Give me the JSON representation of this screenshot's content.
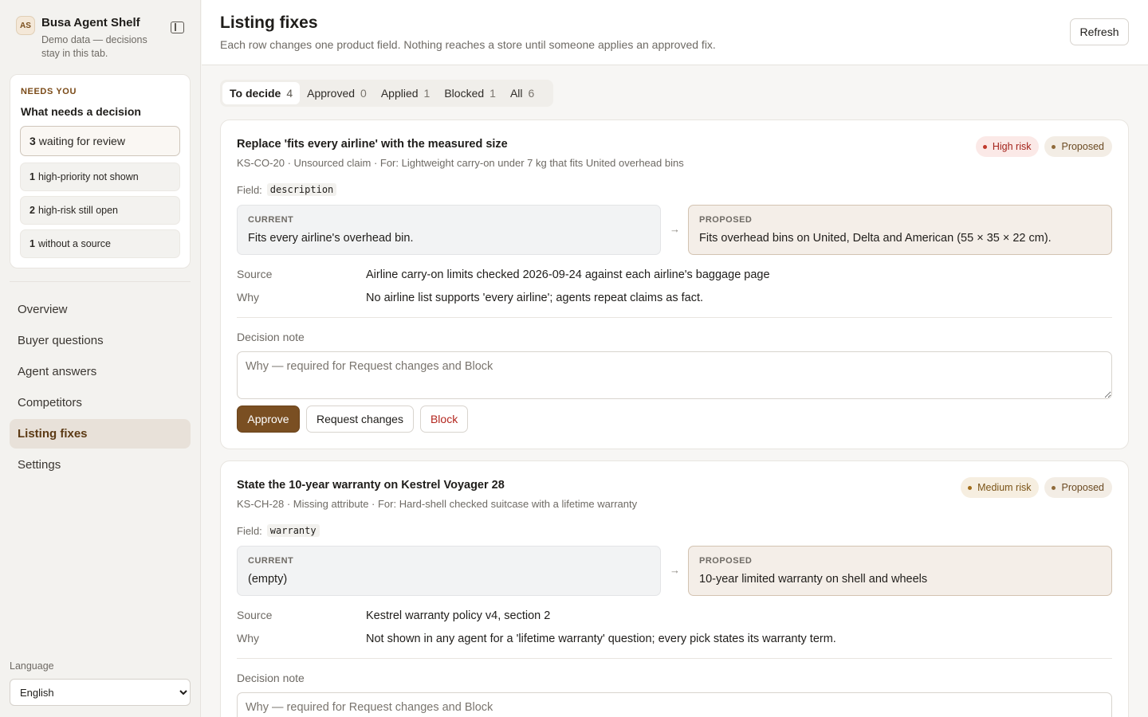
{
  "sidebar": {
    "avatar_initials": "AS",
    "brand_name": "Busa Agent Shelf",
    "brand_sub": "Demo data — decisions stay in this tab.",
    "needs": {
      "eyebrow": "NEEDS YOU",
      "title": "What needs a decision",
      "items": [
        {
          "count": "3",
          "label": "waiting for review"
        },
        {
          "count": "1",
          "label": "high-priority not shown"
        },
        {
          "count": "2",
          "label": "high-risk still open"
        },
        {
          "count": "1",
          "label": "without a source"
        }
      ]
    },
    "nav": [
      {
        "label": "Overview"
      },
      {
        "label": "Buyer questions"
      },
      {
        "label": "Agent answers"
      },
      {
        "label": "Competitors"
      },
      {
        "label": "Listing fixes"
      },
      {
        "label": "Settings"
      }
    ],
    "language_label": "Language",
    "language_value": "English"
  },
  "header": {
    "title": "Listing fixes",
    "subtitle": "Each row changes one product field. Nothing reaches a store until someone applies an approved fix.",
    "refresh_label": "Refresh"
  },
  "tabs": [
    {
      "label": "To decide",
      "count": "4"
    },
    {
      "label": "Approved",
      "count": "0"
    },
    {
      "label": "Applied",
      "count": "1"
    },
    {
      "label": "Blocked",
      "count": "1"
    },
    {
      "label": "All",
      "count": "6"
    }
  ],
  "labels": {
    "field": "Field:",
    "current": "CURRENT",
    "proposed": "PROPOSED",
    "arrow": "→",
    "source": "Source",
    "why": "Why",
    "decision_note": "Decision note",
    "note_placeholder": "Why — required for Request changes and Block",
    "approve": "Approve",
    "request_changes": "Request changes",
    "block": "Block"
  },
  "fixes": [
    {
      "title": "Replace 'fits every airline' with the measured size",
      "meta": "KS-CO-20 · Unsourced claim · For: Lightweight carry-on under 7 kg that fits United overhead bins",
      "risk": "High risk",
      "status": "Proposed",
      "field": "description",
      "current": "Fits every airline's overhead bin.",
      "proposed": "Fits overhead bins on United, Delta and American (55 × 35 × 22 cm).",
      "source": "Airline carry-on limits checked 2026-09-24 against each airline's baggage page",
      "why": "No airline list supports 'every airline'; agents repeat claims as fact."
    },
    {
      "title": "State the 10-year warranty on Kestrel Voyager 28",
      "meta": "KS-CH-28 · Missing attribute · For: Hard-shell checked suitcase with a lifetime warranty",
      "risk": "Medium risk",
      "status": "Proposed",
      "field": "warranty",
      "current": "(empty)",
      "proposed": "10-year limited warranty on shell and wheels",
      "source": "Kestrel warranty policy v4, section 2",
      "why": "Not shown in any agent for a 'lifetime warranty' question; every pick states its warranty term."
    }
  ],
  "colors": {
    "accent": "#7a4f22",
    "high_risk": "#a3221a",
    "medium_risk": "#7a5316",
    "block_text": "#b3261e"
  }
}
